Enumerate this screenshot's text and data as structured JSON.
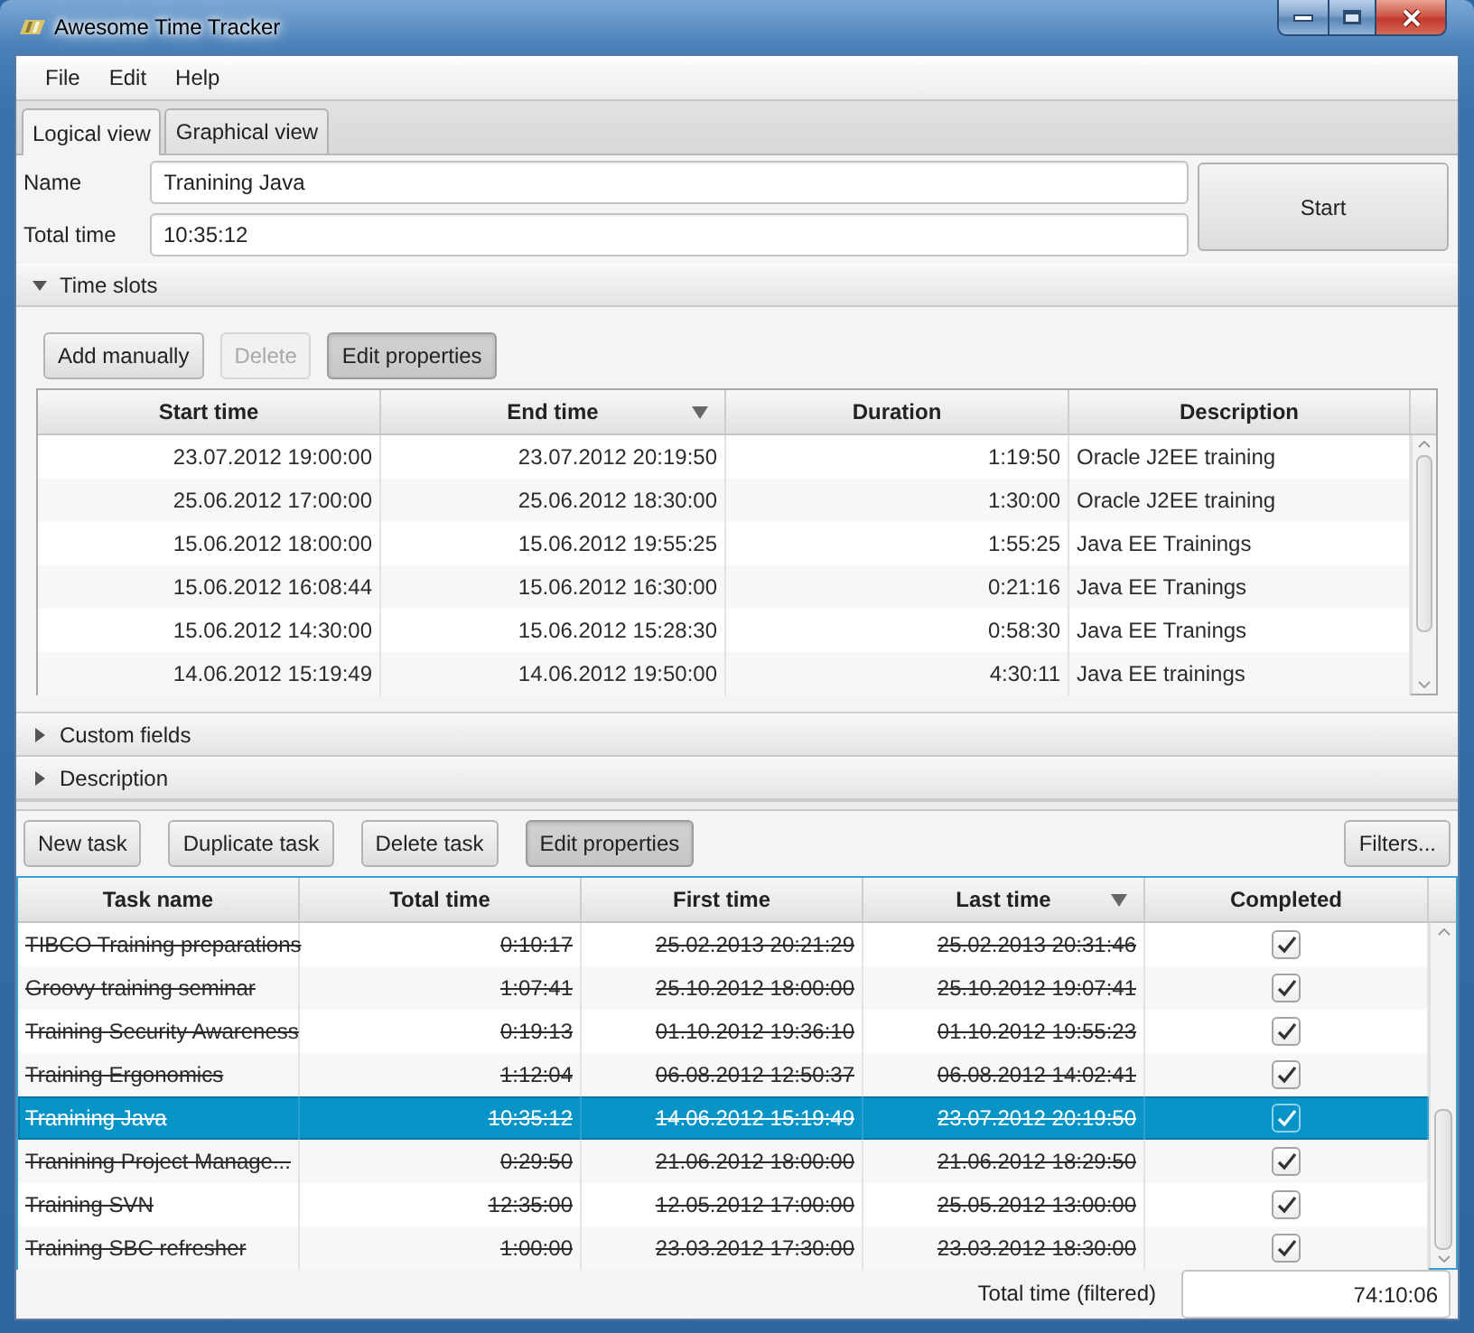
{
  "window": {
    "title": "Awesome Time Tracker"
  },
  "menu": [
    "File",
    "Edit",
    "Help"
  ],
  "tabs": [
    {
      "label": "Logical view",
      "selected": true
    },
    {
      "label": "Graphical view",
      "selected": false
    }
  ],
  "form": {
    "fields": [
      {
        "label": "Name",
        "value": "Tranining Java"
      },
      {
        "label": "Total time",
        "value": "10:35:12"
      }
    ],
    "start_button": "Start"
  },
  "sections": [
    {
      "title": "Time slots",
      "expanded": true,
      "buttons": [
        {
          "label": "Add manually",
          "disabled": false,
          "pressed": false
        },
        {
          "label": "Delete",
          "disabled": true,
          "pressed": false
        },
        {
          "label": "Edit properties",
          "disabled": false,
          "pressed": true
        }
      ],
      "table": {
        "columns": [
          {
            "label": "Start time",
            "kind": "time",
            "sorted": false
          },
          {
            "label": "End time",
            "kind": "time",
            "sorted": true
          },
          {
            "label": "Duration",
            "kind": "time",
            "sorted": false
          },
          {
            "label": "Description",
            "kind": "text",
            "sorted": false
          }
        ],
        "rows": [
          [
            "23.07.2012 19:00:00",
            "23.07.2012 20:19:50",
            "1:19:50",
            "Oracle J2EE training"
          ],
          [
            "25.06.2012 17:00:00",
            "25.06.2012 18:30:00",
            "1:30:00",
            "Oracle J2EE training"
          ],
          [
            "15.06.2012 18:00:00",
            "15.06.2012 19:55:25",
            "1:55:25",
            "Java EE Trainings"
          ],
          [
            "15.06.2012 16:08:44",
            "15.06.2012 16:30:00",
            "0:21:16",
            "Java EE Tranings"
          ],
          [
            "15.06.2012 14:30:00",
            "15.06.2012 15:28:30",
            "0:58:30",
            "Java EE Tranings"
          ],
          [
            "14.06.2012 15:19:49",
            "14.06.2012 19:50:00",
            "4:30:11",
            "Java EE trainings"
          ]
        ]
      }
    },
    {
      "title": "Custom fields",
      "expanded": false
    },
    {
      "title": "Description",
      "expanded": false
    }
  ],
  "tasks": {
    "buttons": [
      {
        "label": "New task",
        "disabled": false,
        "pressed": false
      },
      {
        "label": "Duplicate task",
        "disabled": false,
        "pressed": false
      },
      {
        "label": "Delete task",
        "disabled": false,
        "pressed": false
      },
      {
        "label": "Edit properties",
        "disabled": false,
        "pressed": true
      }
    ],
    "filters_button": "Filters...",
    "table": {
      "columns": [
        {
          "label": "Task name",
          "kind": "text",
          "sorted": false
        },
        {
          "label": "Total time",
          "kind": "time",
          "sorted": false
        },
        {
          "label": "First time",
          "kind": "time",
          "sorted": false
        },
        {
          "label": "Last time",
          "kind": "time",
          "sorted": true
        },
        {
          "label": "Completed",
          "kind": "check",
          "sorted": false
        }
      ],
      "rows": [
        {
          "cells": [
            "TIBCO Training preparations",
            "0:10:17",
            "25.02.2013 20:21:29",
            "25.02.2013 20:31:46"
          ],
          "completed": true,
          "selected": false
        },
        {
          "cells": [
            "Groovy training seminar",
            "1:07:41",
            "25.10.2012 18:00:00",
            "25.10.2012 19:07:41"
          ],
          "completed": true,
          "selected": false
        },
        {
          "cells": [
            "Training Security Awareness",
            "0:19:13",
            "01.10.2012 19:36:10",
            "01.10.2012 19:55:23"
          ],
          "completed": true,
          "selected": false
        },
        {
          "cells": [
            "Training Ergonomics",
            "1:12:04",
            "06.08.2012 12:50:37",
            "06.08.2012 14:02:41"
          ],
          "completed": true,
          "selected": false
        },
        {
          "cells": [
            "Tranining Java",
            "10:35:12",
            "14.06.2012 15:19:49",
            "23.07.2012 20:19:50"
          ],
          "completed": true,
          "selected": true
        },
        {
          "cells": [
            "Tranining Project Manage...",
            "0:29:50",
            "21.06.2012 18:00:00",
            "21.06.2012 18:29:50"
          ],
          "completed": true,
          "selected": false
        },
        {
          "cells": [
            "Training SVN",
            "12:35:00",
            "12.05.2012 17:00:00",
            "25.05.2012 13:00:00"
          ],
          "completed": true,
          "selected": false
        },
        {
          "cells": [
            "Training SBC refresher",
            "1:00:00",
            "23.03.2012 17:30:00",
            "23.03.2012 18:30:00"
          ],
          "completed": true,
          "selected": false
        }
      ]
    },
    "footer": {
      "label": "Total time (filtered)",
      "value": "74:10:06"
    }
  }
}
